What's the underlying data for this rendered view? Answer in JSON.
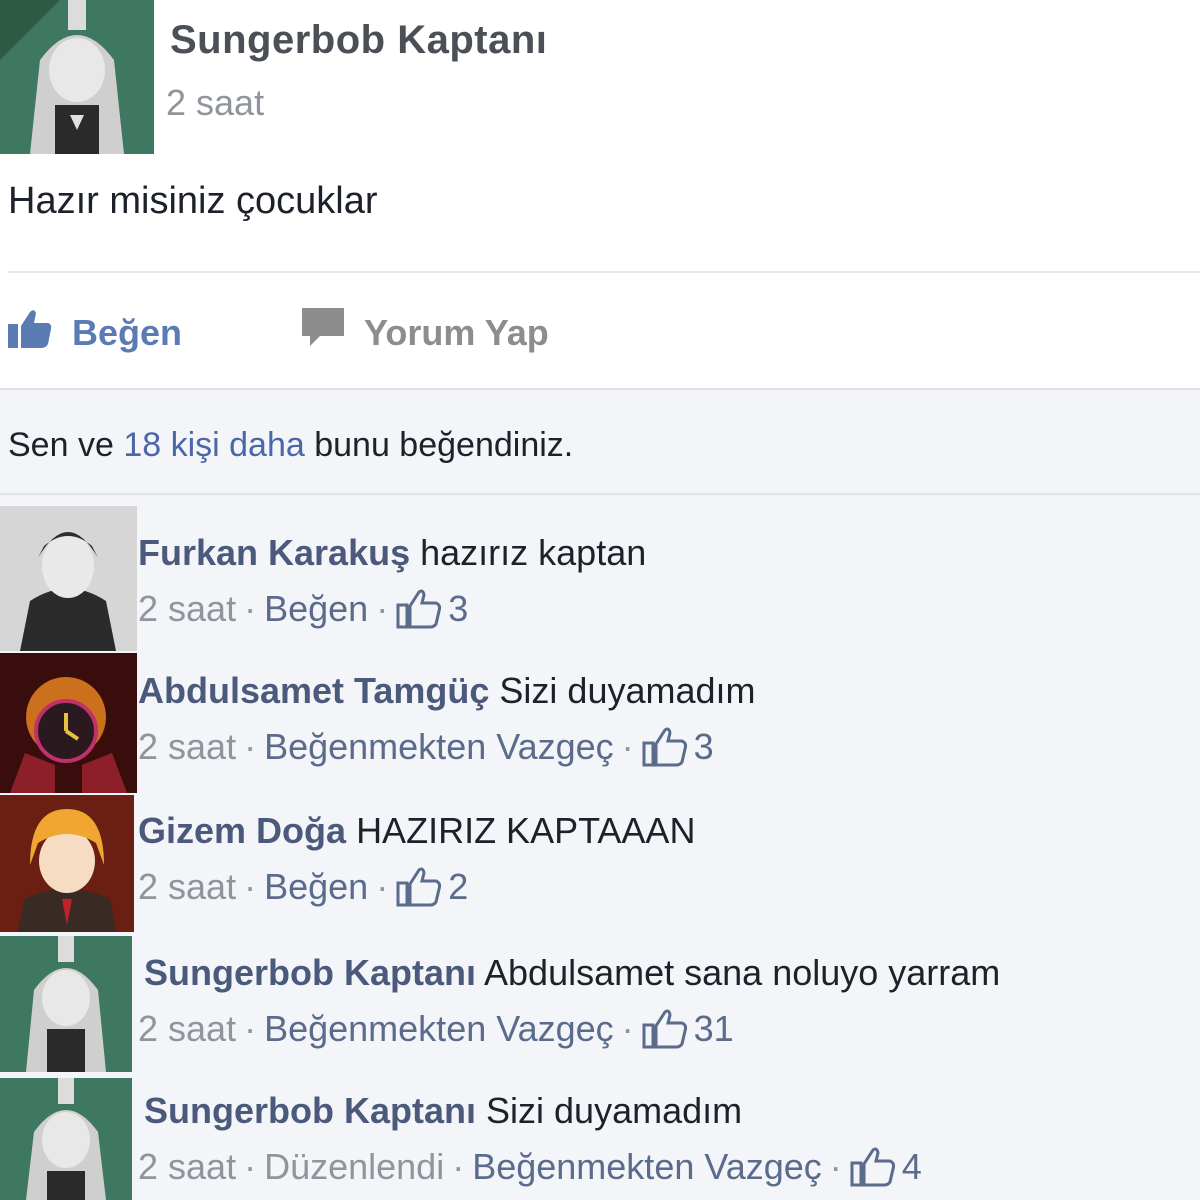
{
  "post": {
    "author": "Sungerbob Kaptanı",
    "time": "2 saat",
    "text": "Hazır misiniz çocuklar"
  },
  "actions": {
    "like": "Beğen",
    "comment": "Yorum Yap"
  },
  "likes_summary": {
    "prefix": "Sen ve ",
    "others": "18 kişi daha",
    "suffix": " bunu beğendiniz."
  },
  "comments": [
    {
      "author": "Furkan Karakuş",
      "text": "hazırız kaptan",
      "time": "2 saat",
      "action": "Beğen",
      "likes": "3"
    },
    {
      "author": "Abdulsamet Tamgüç",
      "text": "Sizi duyamadım",
      "time": "2 saat",
      "action": "Beğenmekten Vazgeç",
      "likes": "3"
    },
    {
      "author": "Gizem Doğa",
      "text": "HAZIRIZ KAPTAAAN",
      "time": "2 saat",
      "action": "Beğen",
      "likes": "2"
    },
    {
      "author": "Sungerbob Kaptanı",
      "text": "Abdulsamet sana noluyo yarram",
      "time": "2 saat",
      "action": "Beğenmekten Vazgeç",
      "likes": "31"
    },
    {
      "author": "Sungerbob Kaptanı",
      "text": "Sizi duyamadım",
      "time": "2 saat",
      "edited": "Düzenlendi",
      "action": "Beğenmekten Vazgeç",
      "likes": "4"
    }
  ],
  "colors": {
    "link_blue": "#4b5a7c",
    "like_blue": "#5b7bb5",
    "meta_gray": "#90949c",
    "comment_bg": "#f4f5f8"
  }
}
